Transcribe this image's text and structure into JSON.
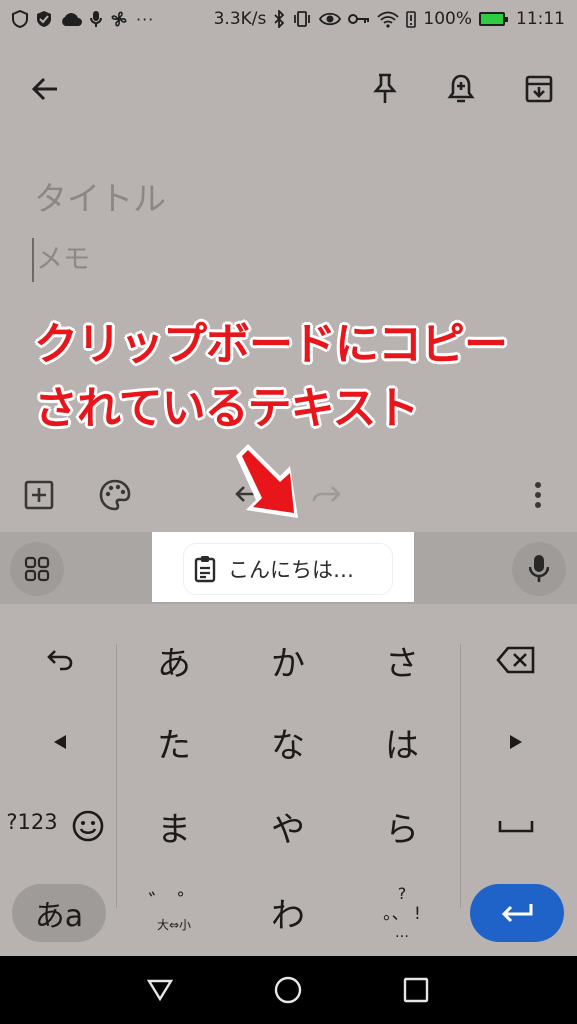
{
  "status_bar": {
    "speed": "3.3K/s",
    "battery": "100%",
    "time": "11:11",
    "left_icons": [
      "shield-outline-icon",
      "shield-check-icon",
      "cloud-icon",
      "mic-icon",
      "fan-icon",
      "more-icon"
    ],
    "right_icons": [
      "bluetooth-icon",
      "vibrate-icon",
      "eye-icon",
      "key-icon",
      "wifi-icon",
      "battery-alert-icon",
      "battery-icon"
    ]
  },
  "app_bar": {
    "icons": [
      "back-arrow-icon",
      "pin-icon",
      "reminder-bell-icon",
      "archive-icon"
    ]
  },
  "editor": {
    "title_placeholder": "タイトル",
    "memo_placeholder": "メモ"
  },
  "annotation": {
    "line1": "クリップボードにコピー",
    "line2": "されているテキスト",
    "arrow_color": "#e8161b"
  },
  "bottom_toolbar": {
    "icons": [
      "add-box-icon",
      "palette-icon",
      "undo-icon",
      "redo-icon",
      "more-vert-icon"
    ]
  },
  "suggestion_strip": {
    "clipboard_text": "こんにちは…",
    "left_icon": "apps-grid-icon",
    "right_icon": "mic-icon"
  },
  "keyboard": {
    "row1": [
      "あ",
      "か",
      "さ"
    ],
    "row2": [
      "た",
      "な",
      "は"
    ],
    "row3": [
      "ま",
      "や",
      "ら"
    ],
    "row4_center": "わ",
    "mode_key": "?123",
    "kana_key": "あa",
    "dakuten_top": "゛ ゜",
    "dakuten_bottom": "大⇔小",
    "punct_top": "?",
    "punct_mid": "。、 !",
    "punct_bottom": "…",
    "enter_color": "#1f63c9"
  },
  "nav_bar": {
    "icons": [
      "back-triangle-icon",
      "home-circle-icon",
      "recents-square-icon"
    ]
  }
}
